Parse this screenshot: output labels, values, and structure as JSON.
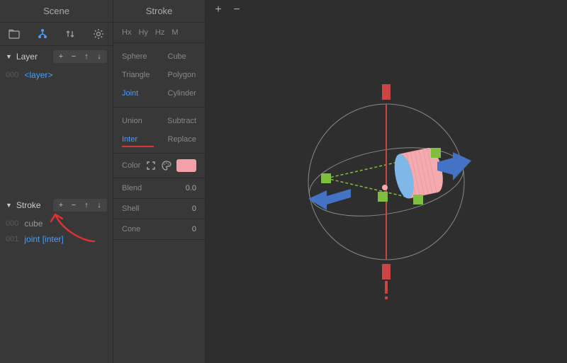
{
  "scene_panel": {
    "title": "Scene",
    "icons": [
      "folder-icon",
      "hierarchy-icon",
      "updown-icon",
      "gear-icon"
    ],
    "layer_section": {
      "label": "Layer",
      "buttons": [
        "+",
        "−",
        "↑",
        "↓"
      ],
      "items": [
        {
          "idx": "000",
          "name": "<layer>"
        }
      ]
    },
    "stroke_section": {
      "label": "Stroke",
      "buttons": [
        "+",
        "−",
        "↑",
        "↓"
      ],
      "items": [
        {
          "idx": "000",
          "name": "cube"
        },
        {
          "idx": "001",
          "name": "joint [inter]"
        }
      ]
    }
  },
  "stroke_panel": {
    "title": "Stroke",
    "hatch": [
      "Hx",
      "Hy",
      "Hz",
      "M"
    ],
    "shapes": [
      [
        "Sphere",
        "Cube"
      ],
      [
        "Triangle",
        "Polygon"
      ],
      [
        "Joint",
        "Cylinder"
      ]
    ],
    "ops": [
      [
        "Union",
        "Subtract"
      ],
      [
        "Inter",
        "Replace"
      ]
    ],
    "props": {
      "color_label": "Color",
      "color_hex": "#f4a0a8",
      "blend_label": "Blend",
      "blend_value": "0.0",
      "shell_label": "Shell",
      "shell_value": "0",
      "cone_label": "Cone",
      "cone_value": "0"
    },
    "active_shape": "Joint",
    "active_op": "Inter"
  },
  "viewport": {
    "toolbar": [
      "+",
      "−"
    ]
  }
}
